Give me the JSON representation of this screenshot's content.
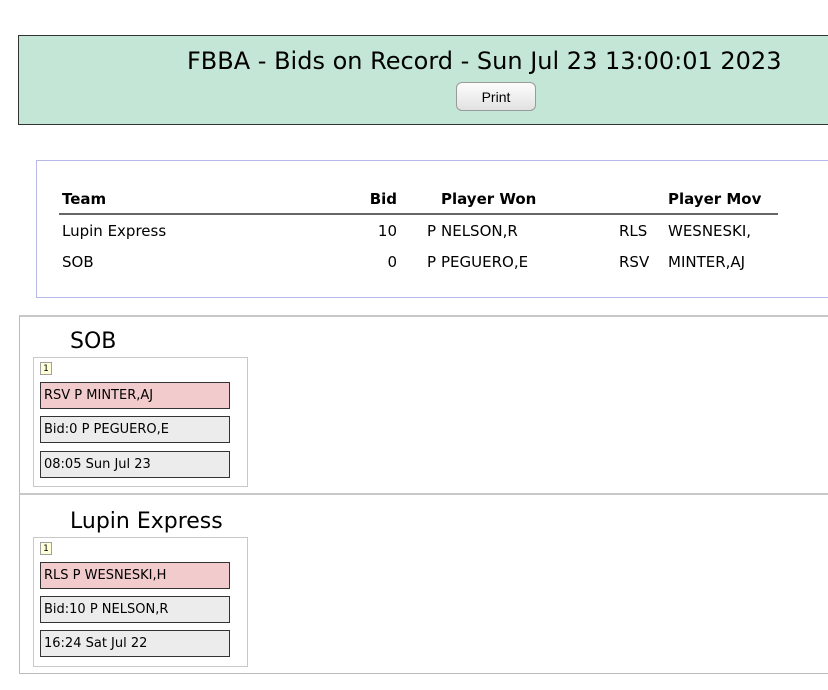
{
  "header": {
    "title": "FBBA - Bids on Record - Sun Jul 23 13:00:01 2023",
    "print_label": "Print",
    "background": "#c4e6d6"
  },
  "summary": {
    "columns": [
      "Team",
      "Bid",
      "Player Won",
      "",
      "Player Mov"
    ],
    "rows": [
      {
        "team": "Lupin Express",
        "bid": "10",
        "pos": "P",
        "player_won": "NELSON,R",
        "code": "RLS",
        "player_moved": "WESNESKI,"
      },
      {
        "team": "SOB",
        "bid": "0",
        "pos": "P",
        "player_won": "PEGUERO,E",
        "code": "RSV",
        "player_moved": "MINTER,AJ"
      }
    ]
  },
  "teams": [
    {
      "name": "SOB",
      "badge": "1",
      "move": "RSV P MINTER,AJ",
      "bid": "Bid:0 P PEGUERO,E",
      "time": "08:05 Sun Jul 23"
    },
    {
      "name": "Lupin Express",
      "badge": "1",
      "move": "RLS P WESNESKI,H",
      "bid": "Bid:10 P NELSON,R",
      "time": "16:24 Sat Jul 22"
    }
  ]
}
